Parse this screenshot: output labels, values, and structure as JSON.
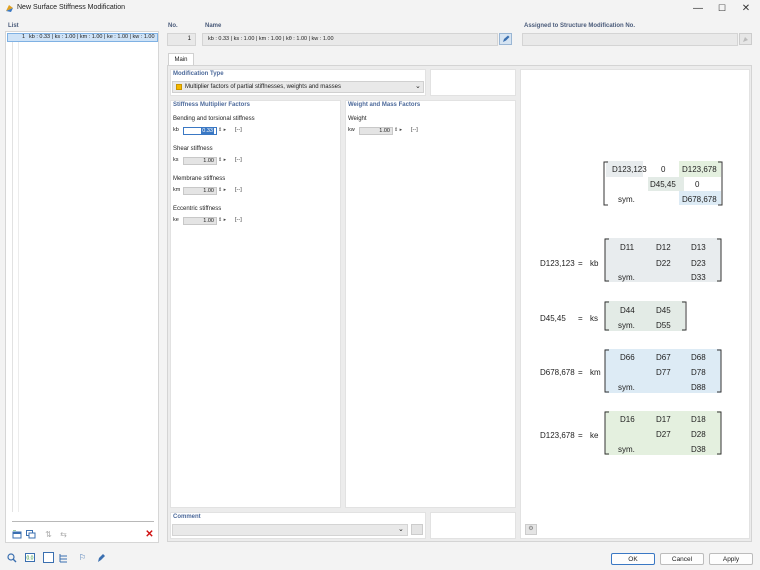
{
  "window": {
    "title": "New Surface Stiffness Modification",
    "minimize": "—",
    "maximize": "☐",
    "close": "✕"
  },
  "list": {
    "header": "List",
    "items": [
      {
        "number": "1",
        "text": "kb : 0.33 | ks : 1.00 | km : 1.00 | ke : 1.00 | kw : 1.00"
      }
    ]
  },
  "no": {
    "label": "No.",
    "value": "1"
  },
  "name": {
    "label": "Name",
    "value": "kb : 0.33 | ks : 1.00 | km : 1.00 | kθ : 1.00 | kw : 1.00"
  },
  "assigned": {
    "label": "Assigned to Structure Modification No.",
    "value": ""
  },
  "tabs": [
    {
      "label": "Main"
    }
  ],
  "modification_type": {
    "header": "Modification Type",
    "selected": "Multiplier factors of partial stiffnesses, weights and masses",
    "swatch_color": "#f5b800"
  },
  "stiffness": {
    "header": "Stiffness Multiplier Factors",
    "groups": [
      {
        "label": "Bending and torsional stiffness",
        "symbol": "kb",
        "value": "0.33",
        "unit": "[--]"
      },
      {
        "label": "Shear stiffness",
        "symbol": "ks",
        "value": "1.00",
        "unit": "[--]"
      },
      {
        "label": "Membrane stiffness",
        "symbol": "km",
        "value": "1.00",
        "unit": "[--]"
      },
      {
        "label": "Eccentric stiffness",
        "symbol": "ke",
        "value": "1.00",
        "unit": "[--]"
      }
    ]
  },
  "weight": {
    "header": "Weight and Mass Factors",
    "groups": [
      {
        "label": "Weight",
        "symbol": "kw",
        "value": "1.00",
        "unit": "[--]"
      }
    ]
  },
  "comment": {
    "label": "Comment",
    "value": ""
  },
  "diagram": {
    "overall": {
      "d123": "D123,123",
      "zero1": "0",
      "d123678": "D123,678",
      "d4545": "D45,45",
      "zero2": "0",
      "sym": "sym.",
      "d678": "D678,678"
    },
    "bending": {
      "lhs": "D123,123",
      "eq": "=",
      "k": "kb",
      "d11": "D11",
      "d12": "D12",
      "d13": "D13",
      "d22": "D22",
      "d23": "D23",
      "sym": "sym.",
      "d33": "D33"
    },
    "shear": {
      "lhs": "D45,45",
      "eq": "=",
      "k": "ks",
      "d44": "D44",
      "d45": "D45",
      "sym": "sym.",
      "d55": "D55"
    },
    "membrane": {
      "lhs": "D678,678",
      "eq": "=",
      "k": "km",
      "d66": "D66",
      "d67": "D67",
      "d68": "D68",
      "d77": "D77",
      "d78": "D78",
      "sym": "sym.",
      "d88": "D88"
    },
    "eccentric": {
      "lhs": "D123,678",
      "eq": "=",
      "k": "ke",
      "d16": "D16",
      "d17": "D17",
      "d18": "D18",
      "d27": "D27",
      "d28": "D28",
      "sym": "sym.",
      "d38": "D38"
    },
    "colors": {
      "bending": "#e8ecee",
      "shear": "#e3ebe6",
      "membrane": "#ddebf5",
      "eccentric": "#e4f0df"
    }
  },
  "buttons": {
    "ok": "OK",
    "cancel": "Cancel",
    "apply": "Apply"
  }
}
